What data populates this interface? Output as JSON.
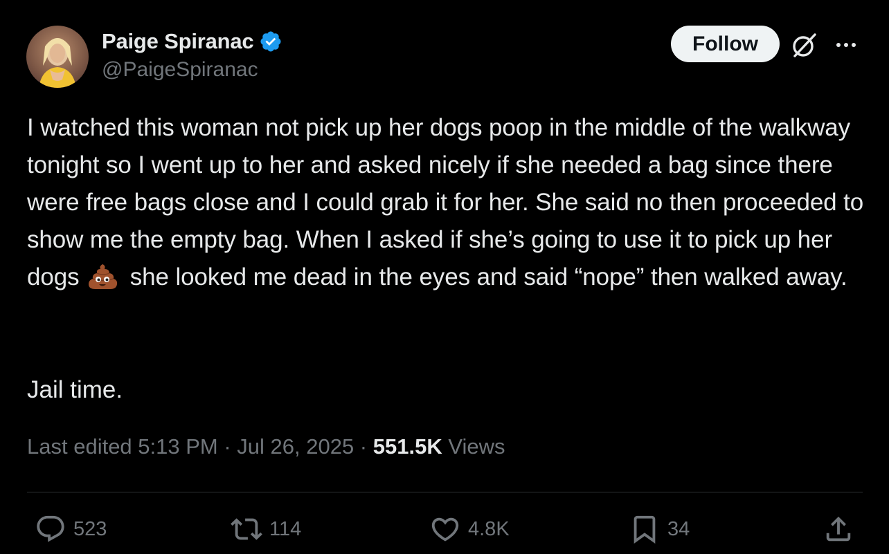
{
  "author": {
    "display_name": "Paige Spiranac",
    "handle": "@PaigeSpiranac",
    "verified": true,
    "verified_color": "#1d9bf0"
  },
  "header": {
    "follow_label": "Follow",
    "grok_icon": "grok-icon",
    "more_icon": "more-icon"
  },
  "tweet": {
    "text_before_emoji": "I watched this woman not pick up her dogs poop in the middle of the walkway tonight so I went up to her and asked nicely if she needed a bag since there were free bags close and I could grab it for her. She said no then proceeded to show me the empty bag. When I asked if she’s going to use it to pick up her dogs",
    "emoji": "poop-emoji",
    "text_after_emoji": "she looked me dead in the eyes and said “nope” then walked away.",
    "closing_line": "Jail time."
  },
  "meta": {
    "edited_label": "Last edited 5:13 PM · Jul 26, 2025 · ",
    "views_count": "551.5K",
    "views_label": " Views"
  },
  "actions": {
    "replies": "523",
    "reposts": "114",
    "likes": "4.8K",
    "bookmarks": "34"
  },
  "colors": {
    "background": "#000000",
    "text_primary": "#e7e9ea",
    "text_secondary": "#71767b",
    "divider": "#2f3336",
    "follow_bg": "#eff3f4"
  }
}
